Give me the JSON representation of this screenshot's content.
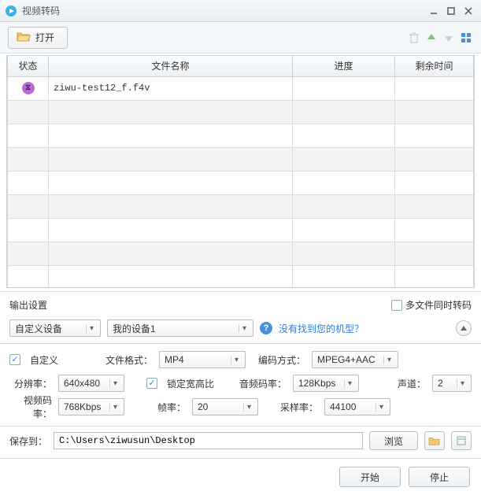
{
  "window": {
    "title": "视频转码"
  },
  "toolbar": {
    "open_label": "打开"
  },
  "table": {
    "headers": {
      "status": "状态",
      "filename": "文件名称",
      "progress": "进度",
      "remaining": "剩余时间"
    },
    "rows": [
      {
        "filename": "ziwu-test12_f.f4v",
        "status_icon": "hourglass"
      }
    ]
  },
  "output": {
    "section_label": "输出设置",
    "multi_file_label": "多文件同时转码",
    "device_type": "自定义设备",
    "device_name": "我的设备1",
    "model_help": "没有找到您的机型？",
    "custom_label": "自定义",
    "fields": {
      "file_format_label": "文件格式：",
      "file_format": "MP4",
      "encode_label": "编码方式：",
      "encode": "MPEG4+AAC",
      "resolution_label": "分辨率：",
      "resolution": "640x480",
      "lock_aspect_label": "锁定宽高比",
      "audio_bitrate_label": "音频码率：",
      "audio_bitrate": "128Kbps",
      "channels_label": "声道：",
      "channels": "2",
      "video_bitrate_label": "视频码率：",
      "video_bitrate": "768Kbps",
      "fps_label": "帧率：",
      "fps": "20",
      "sample_rate_label": "采样率：",
      "sample_rate": "44100"
    }
  },
  "save": {
    "label": "保存到：",
    "path": "C:\\Users\\ziwusun\\Desktop",
    "browse_label": "浏览"
  },
  "actions": {
    "start": "开始",
    "stop": "停止"
  }
}
